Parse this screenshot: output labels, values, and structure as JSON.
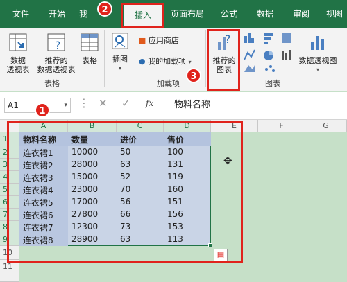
{
  "tabs": [
    "文件",
    "开始",
    "插入",
    "页面布局",
    "公式",
    "数据",
    "审阅",
    "视图"
  ],
  "tab_partial": "我",
  "ribbon": {
    "pivot": "数据\n透视表",
    "rec_pivot": "推荐的\n数据透视表",
    "table": "表格",
    "group_tables": "表格",
    "illustrations": "插图",
    "app_store": "应用商店",
    "my_addins": "我的加载项",
    "group_addins": "加载项",
    "rec_charts": "推荐的\n图表",
    "pivot_chart": "数据透视图",
    "group_charts": "图表"
  },
  "formula_bar": {
    "name_box": "A1",
    "fx": "fx",
    "content": "物料名称"
  },
  "columns": [
    "A",
    "B",
    "C",
    "D",
    "E",
    "F",
    "G"
  ],
  "rows": [
    "1",
    "2",
    "3",
    "4",
    "5",
    "6",
    "7",
    "8",
    "9",
    "10",
    "11"
  ],
  "table": {
    "headers": [
      "物料名称",
      "数量",
      "进价",
      "售价"
    ],
    "rows": [
      [
        "连衣裙1",
        "10000",
        "50",
        "100"
      ],
      [
        "连衣裙2",
        "28000",
        "63",
        "131"
      ],
      [
        "连衣裙3",
        "15000",
        "52",
        "119"
      ],
      [
        "连衣裙4",
        "23000",
        "70",
        "160"
      ],
      [
        "连衣裙5",
        "17000",
        "56",
        "151"
      ],
      [
        "连衣裙6",
        "27800",
        "66",
        "156"
      ],
      [
        "连衣裙7",
        "12300",
        "73",
        "153"
      ],
      [
        "连衣裙8",
        "28900",
        "63",
        "113"
      ]
    ]
  },
  "badges": [
    "1",
    "2",
    "3"
  ],
  "colors": {
    "excel_green": "#217346",
    "annotation_red": "#e0231c",
    "selection": "#c9d4e6"
  }
}
